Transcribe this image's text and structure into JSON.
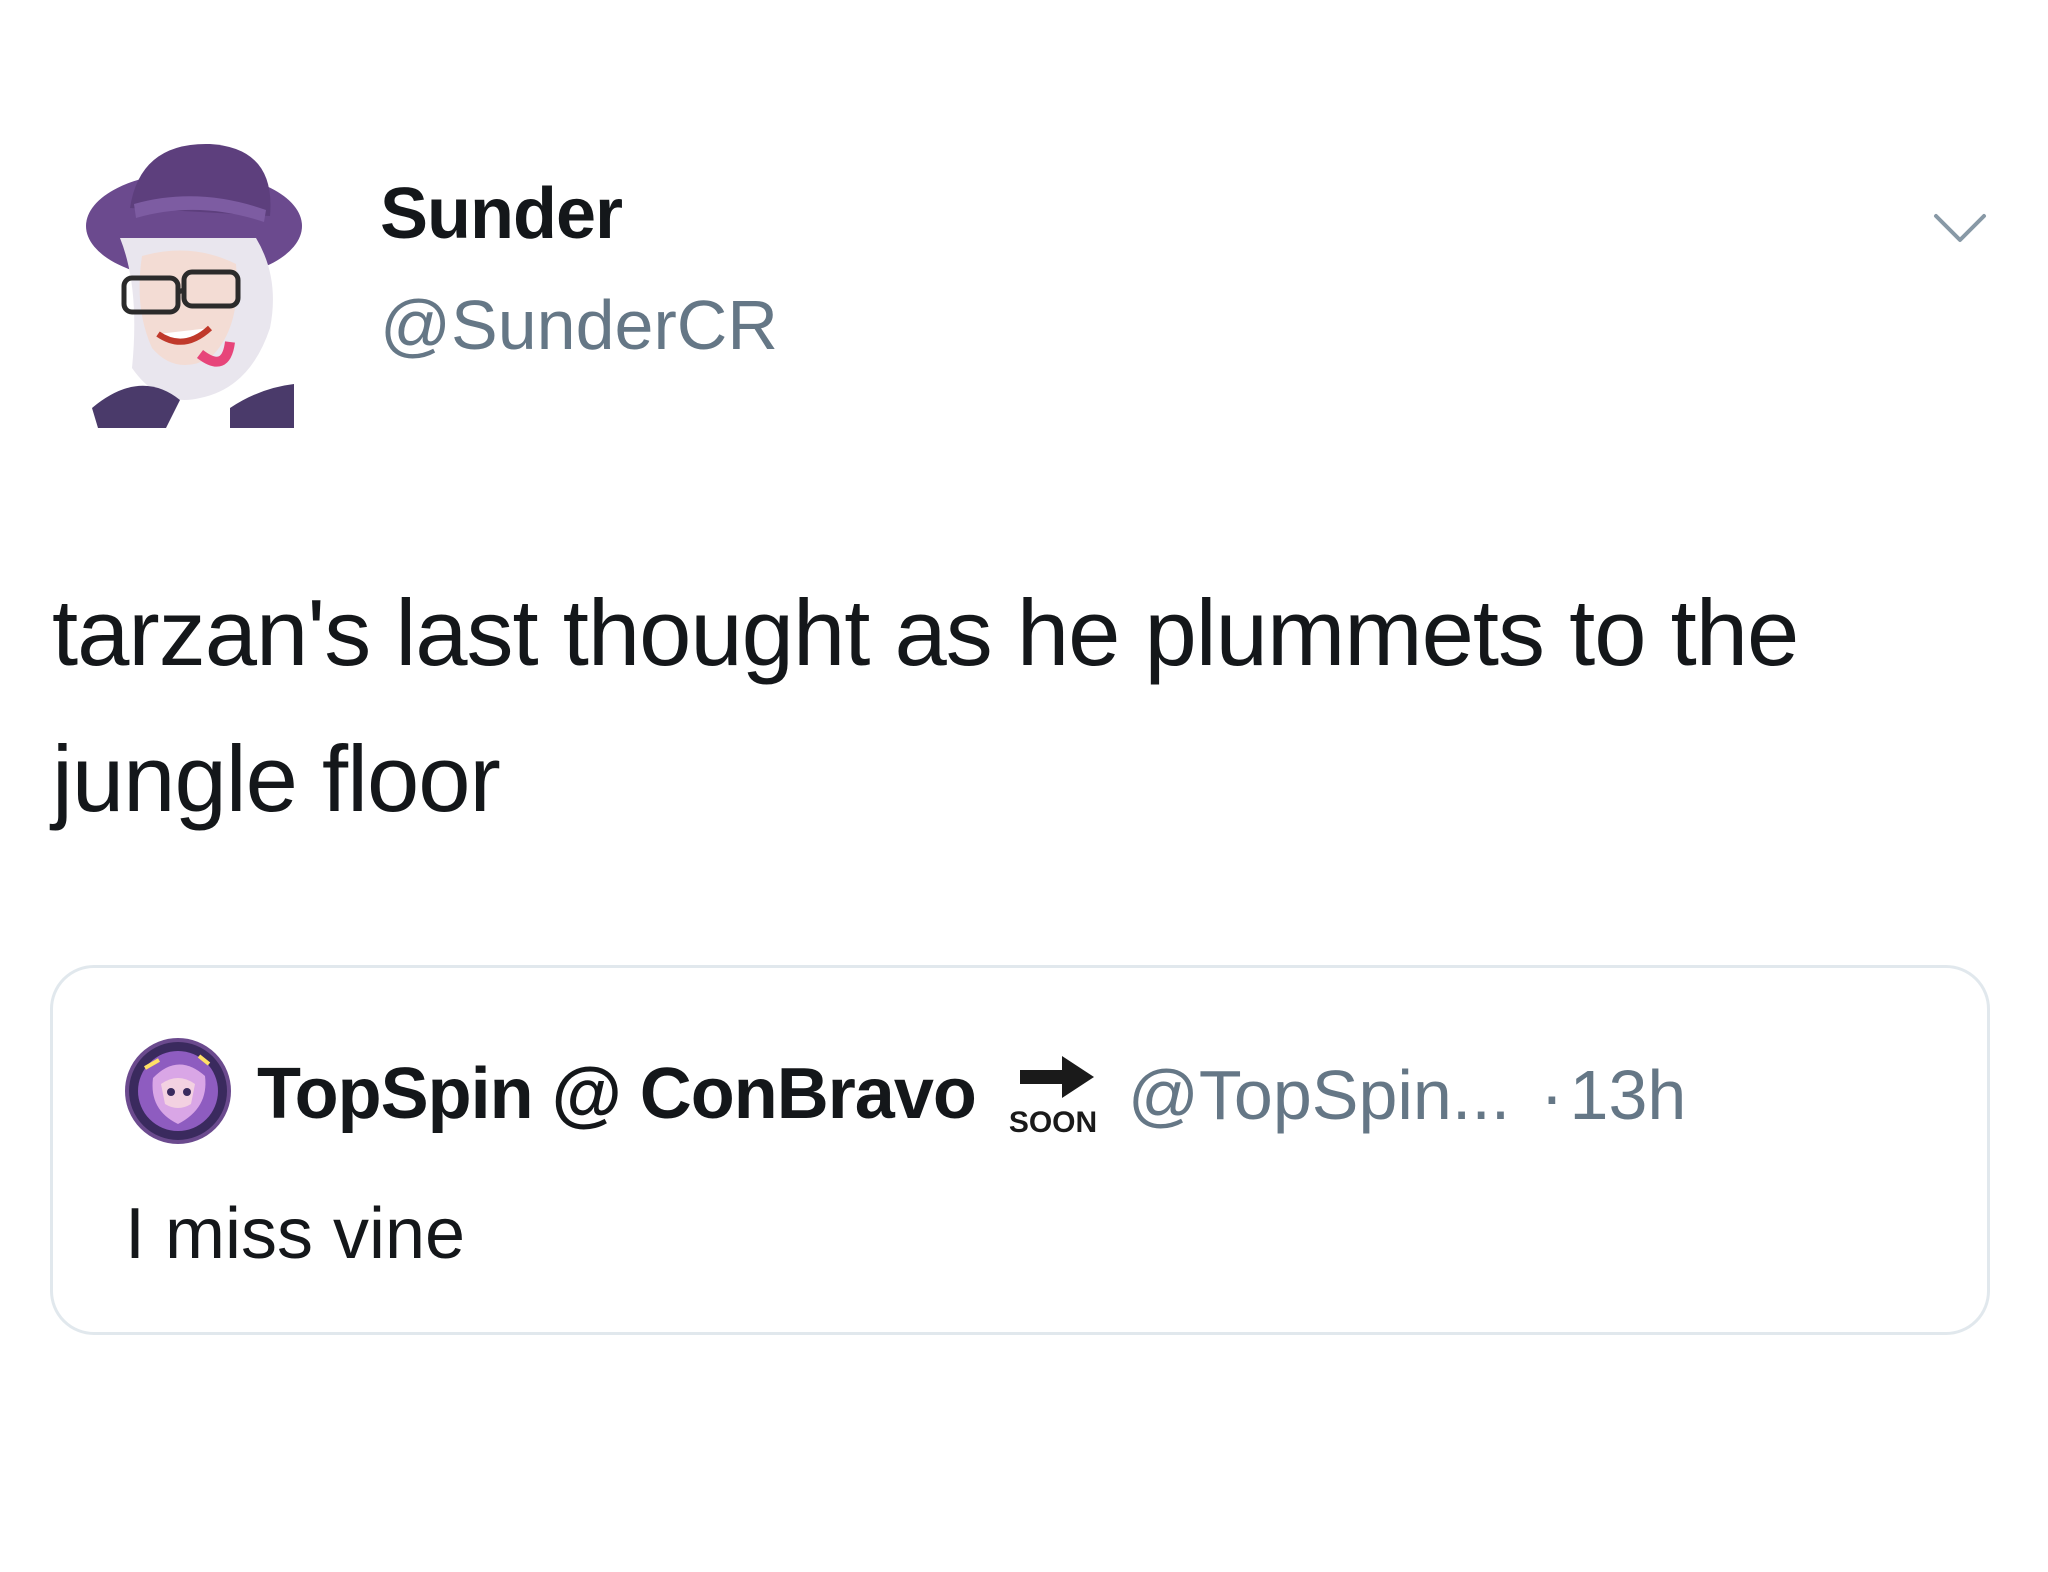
{
  "tweet": {
    "author": {
      "display_name": "Sunder",
      "handle": "@SunderCR",
      "avatar_icon": "illustrated-avatar-purple-hat"
    },
    "menu_icon": "chevron-down-icon",
    "text": "tarzan's last thought as he plummets to the jungle floor",
    "quoted_tweet": {
      "display_name": "TopSpin @ ConBravo",
      "badge_text": "SOON",
      "badge_icon": "arrow-right-icon",
      "handle": "@TopSpin...",
      "separator": "·",
      "time": "13h",
      "text": "I miss vine"
    }
  },
  "colors": {
    "primary_text": "#14171a",
    "secondary_text": "#657786",
    "border": "#e1e8ed",
    "avatar_purple": "#6b4a8e"
  }
}
